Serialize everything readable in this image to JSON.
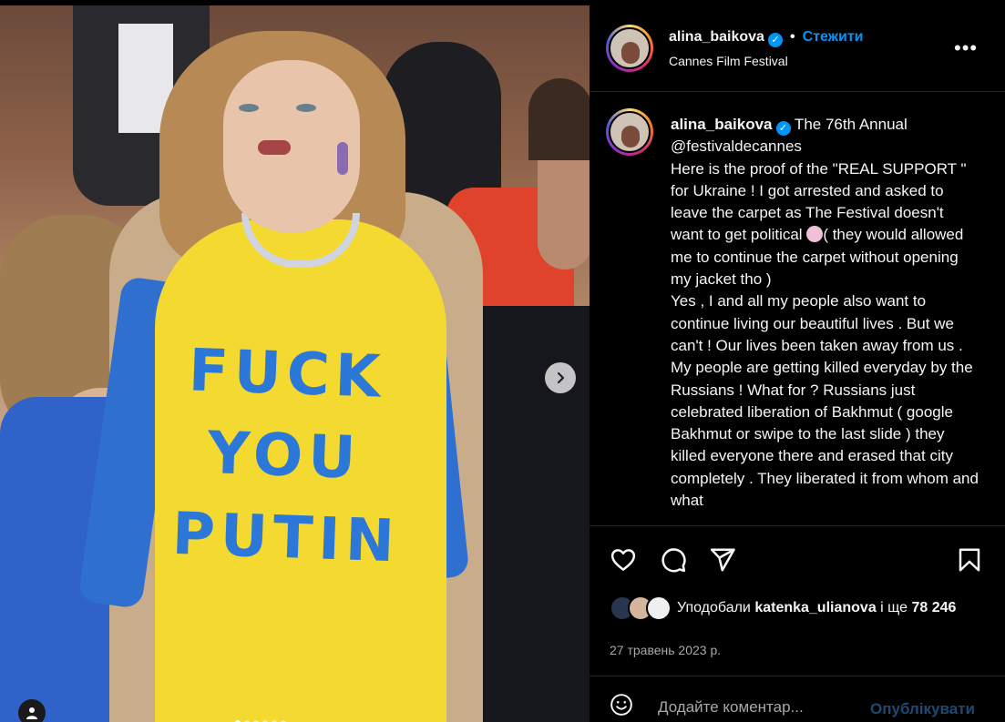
{
  "photo": {
    "slogan_lines": [
      "FUCK",
      "YOU",
      "PUTIN"
    ],
    "next_icon": "chevron-right-icon",
    "user_tag_icon": "person-icon",
    "carousel_dots": 6,
    "active_dot": 0
  },
  "header": {
    "username": "alina_baikova",
    "dot": "•",
    "follow_label": "Стежити",
    "location": "Cannes Film Festival",
    "more_label": "•••"
  },
  "caption": {
    "username": "alina_baikova",
    "text_part1": " The 76th Annual @festivaldecannes\nHere is the proof of the \"REAL SUPPORT \" for Ukraine ! I got arrested and asked to leave the carpet as The Festival doesn't want to get political ",
    "text_part2": "( they would allowed me to continue the carpet without opening my jacket tho )\nYes , I and all my people also want to continue living our beautiful lives . But we can't ! Our lives been taken away from us . My people are getting killed everyday by the Russians ! What for ? Russians just celebrated liberation of Bakhmut ( google Bakhmut or swipe to the last slide ) they killed everyone there and erased that city completely . They liberated it from whom and what"
  },
  "actions": {
    "like_icon": "heart-icon",
    "comment_icon": "comment-icon",
    "share_icon": "send-icon",
    "save_icon": "bookmark-icon"
  },
  "likes": {
    "prefix": "Уподобали ",
    "user": "katenka_ulianova",
    "middle": " і ще ",
    "count": "78 246"
  },
  "date": "27 травень 2023 р.",
  "comment": {
    "placeholder": "Додайте коментар...",
    "post_label": "Опублікувати"
  },
  "colors": {
    "accent": "#0095f6",
    "background": "#000000",
    "text": "#f5f5f5",
    "muted": "#a8a8a8"
  }
}
